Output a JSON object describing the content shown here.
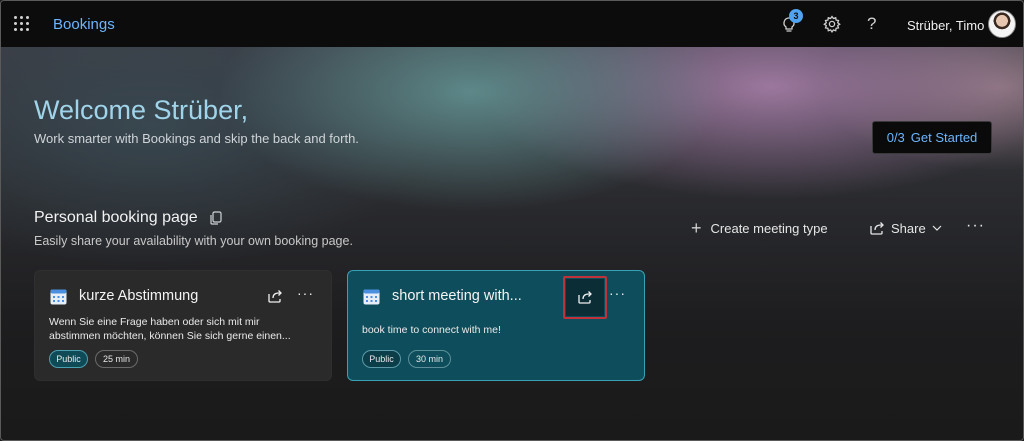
{
  "topbar": {
    "app_title": "Bookings",
    "notification_count": "3",
    "help_symbol": "?",
    "user_name": "Strüber, Timo"
  },
  "hero": {
    "welcome": "Welcome Strüber,",
    "subtitle": "Work smarter with Bookings and skip the back and forth.",
    "get_started_progress": "0/3",
    "get_started_label": "Get Started"
  },
  "section": {
    "title": "Personal booking page",
    "subtitle": "Easily share your availability with your own booking page.",
    "create_label": "Create meeting type",
    "share_label": "Share",
    "more_label": "···"
  },
  "cards": [
    {
      "title": "kurze Abstimmung",
      "desc_line1": "Wenn Sie eine Frage haben oder sich mit mir",
      "desc_line2": "abstimmen möchten, können Sie sich gerne einen...",
      "visibility": "Public",
      "duration": "25 min",
      "more_label": "···"
    },
    {
      "title": "short meeting with...",
      "desc_line1": "book time to connect with me!",
      "visibility": "Public",
      "duration": "30 min",
      "more_label": "···"
    }
  ],
  "colors": {
    "accent": "#6cb5ff",
    "welcome": "#9fd4ea",
    "selected_card": "#0e4e5c",
    "highlight": "#c0313a"
  },
  "icons": [
    "waffle-icon",
    "lightbulb-icon",
    "gear-icon",
    "help-icon",
    "copy-icon",
    "plus-icon",
    "share-icon",
    "chevron-down-icon",
    "calendar-icon",
    "more-icon"
  ]
}
